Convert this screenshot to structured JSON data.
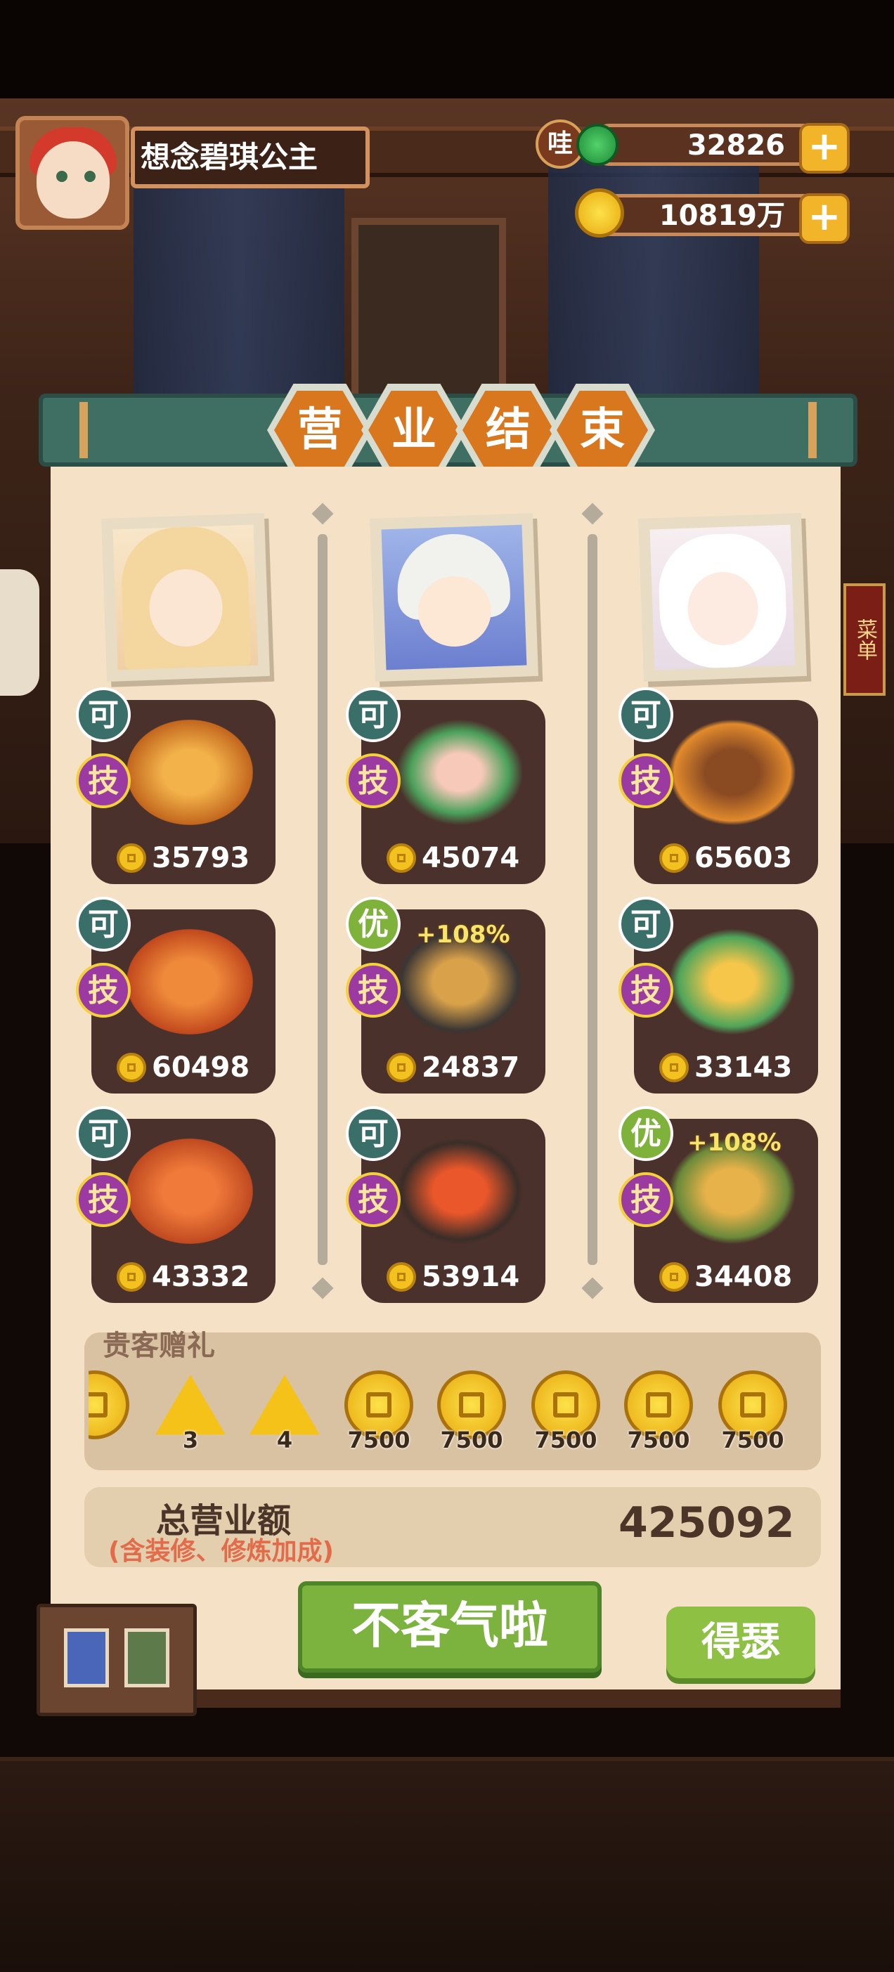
{
  "player": {
    "name": "想念碧琪公主"
  },
  "currency": {
    "gem_icon_label": "哇",
    "gems": "32826",
    "coins": "10819万"
  },
  "banner": {
    "chars": [
      "营",
      "业",
      "结",
      "束"
    ]
  },
  "columns": [
    {
      "dishes": [
        {
          "grade": "可",
          "skill": "技",
          "amount": "35793",
          "bonus": ""
        },
        {
          "grade": "可",
          "skill": "技",
          "amount": "60498",
          "bonus": ""
        },
        {
          "grade": "可",
          "skill": "技",
          "amount": "43332",
          "bonus": ""
        }
      ]
    },
    {
      "dishes": [
        {
          "grade": "可",
          "skill": "技",
          "amount": "45074",
          "bonus": ""
        },
        {
          "grade": "优",
          "skill": "技",
          "amount": "24837",
          "bonus": "+108%"
        },
        {
          "grade": "可",
          "skill": "技",
          "amount": "53914",
          "bonus": ""
        }
      ]
    },
    {
      "dishes": [
        {
          "grade": "可",
          "skill": "技",
          "amount": "65603",
          "bonus": ""
        },
        {
          "grade": "可",
          "skill": "技",
          "amount": "33143",
          "bonus": ""
        },
        {
          "grade": "优",
          "skill": "技",
          "amount": "34408",
          "bonus": "+108%"
        }
      ]
    }
  ],
  "gifts": {
    "title": "贵客赠礼",
    "items": [
      {
        "type": "rice-ball",
        "label": "3"
      },
      {
        "type": "rice-ball",
        "label": "4"
      },
      {
        "type": "coin",
        "label": "7500"
      },
      {
        "type": "coin",
        "label": "7500"
      },
      {
        "type": "coin",
        "label": "7500"
      },
      {
        "type": "coin",
        "label": "7500"
      },
      {
        "type": "coin",
        "label": "7500"
      }
    ]
  },
  "total": {
    "label": "总营业额",
    "note": "(含装修、修炼加成)",
    "value": "425092"
  },
  "buttons": {
    "confirm": "不客气啦",
    "flaunt": "得瑟"
  },
  "side_sign": "菜单",
  "colors": {
    "accent_green": "#7cb33f",
    "banner_orange": "#d9771f",
    "panel_bg": "#f5e2c6",
    "card_bg": "#4a312b"
  }
}
